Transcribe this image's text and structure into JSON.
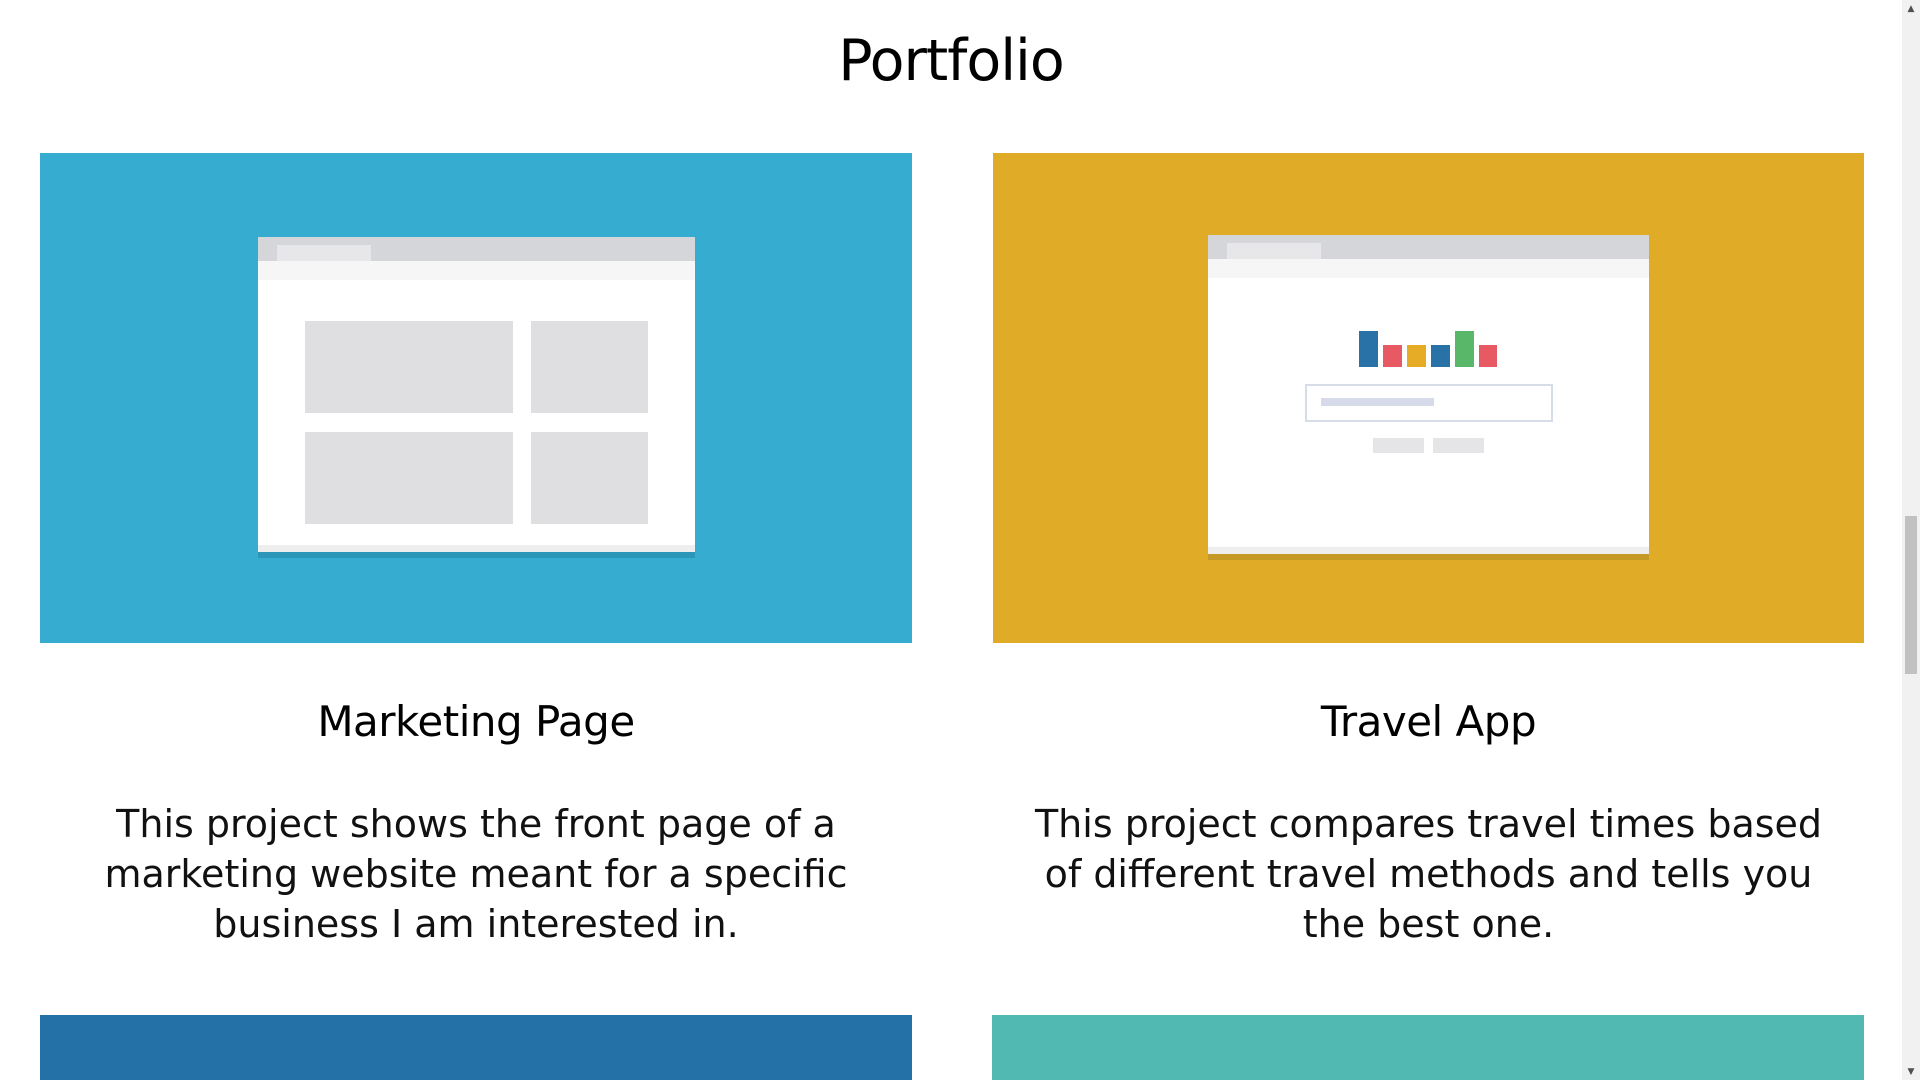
{
  "page": {
    "title": "Portfolio"
  },
  "projects": [
    {
      "title": "Marketing Page",
      "description": "This project shows the front page of a marketing website meant for a specific business I am interested in.",
      "color": "#37acd1"
    },
    {
      "title": "Travel App",
      "description": "This project compares travel times based of different travel methods and tells you the best one.",
      "color": "#e0ab26"
    },
    {
      "color": "#2471a8"
    },
    {
      "color": "#52b9b2"
    }
  ],
  "travel_mock_bars": [
    {
      "color": "#2872a8",
      "level": 1.0
    },
    {
      "color": "#e85a63",
      "level": 0.6
    },
    {
      "color": "#e6ac25",
      "level": 0.6
    },
    {
      "color": "#2872a8",
      "level": 0.6
    },
    {
      "color": "#58b769",
      "level": 1.0
    },
    {
      "color": "#e85a63",
      "level": 0.6
    }
  ],
  "icons": {
    "scroll_up": "chevron-up-icon",
    "scroll_down": "chevron-down-icon"
  },
  "scroll_arrows": {
    "up": "▲",
    "down": "▼"
  }
}
